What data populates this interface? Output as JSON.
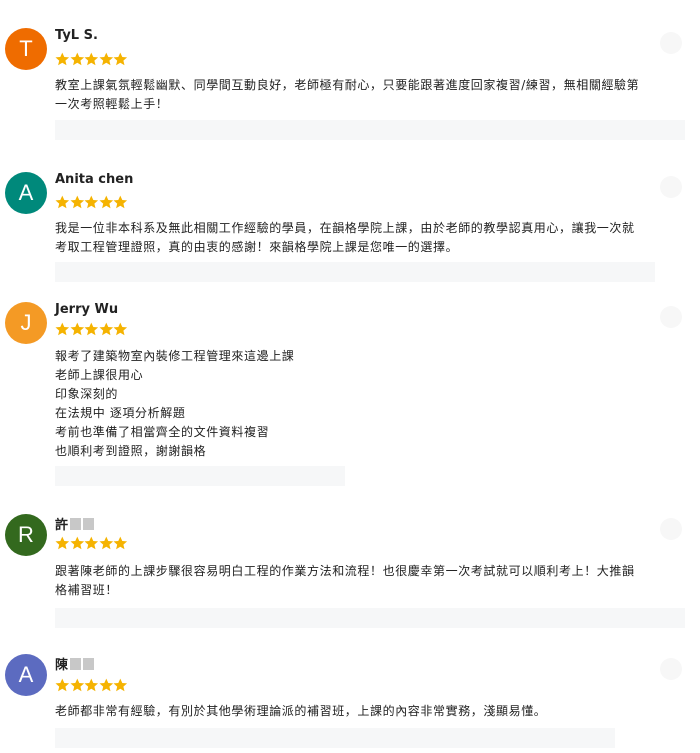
{
  "reviews": [
    {
      "initial": "T",
      "avatar_color": "#ef6c00",
      "name": "TyL S.",
      "name_blur": false,
      "rating": 5,
      "lines": [
        "教室上課氣氛輕鬆幽默、同學間互動良好，老師極有耐心，只要能跟著進度回家複習/練習，無相關經驗第",
        "一次考照輕鬆上手！"
      ]
    },
    {
      "initial": "A",
      "avatar_color": "#00897b",
      "name": "Anita chen",
      "name_blur": false,
      "rating": 5,
      "lines": [
        "我是一位非本科系及無此相關工作經驗的學員，在韻格學院上課，由於老師的教學認真用心，讓我一次就",
        "考取工程管理證照，真的由衷的感謝！來韻格學院上課是您唯一的選擇。"
      ]
    },
    {
      "initial": "J",
      "avatar_color": "#f49a25",
      "name": "Jerry Wu",
      "name_blur": false,
      "rating": 5,
      "lines": [
        "報考了建築物室內裝修工程管理來這邊上課",
        "老師上課很用心",
        "印象深刻的",
        "在法規中 逐項分析解題",
        "考前也準備了相當齊全的文件資料複習",
        "也順利考到證照，謝謝韻格"
      ]
    },
    {
      "initial": "R",
      "avatar_color": "#33691e",
      "name": "許",
      "name_blur": true,
      "rating": 5,
      "lines": [
        "跟著陳老師的上課步驟很容易明白工程的作業方法和流程！也很慶幸第一次考試就可以順利考上！大推韻",
        "格補習班！"
      ]
    },
    {
      "initial": "A",
      "avatar_color": "#5c6bc0",
      "name": "陳",
      "name_blur": true,
      "rating": 5,
      "lines": [
        "老師都非常有經驗，有別於其他學術理論派的補習班，上課的內容非常實務，淺顯易懂。"
      ]
    }
  ]
}
